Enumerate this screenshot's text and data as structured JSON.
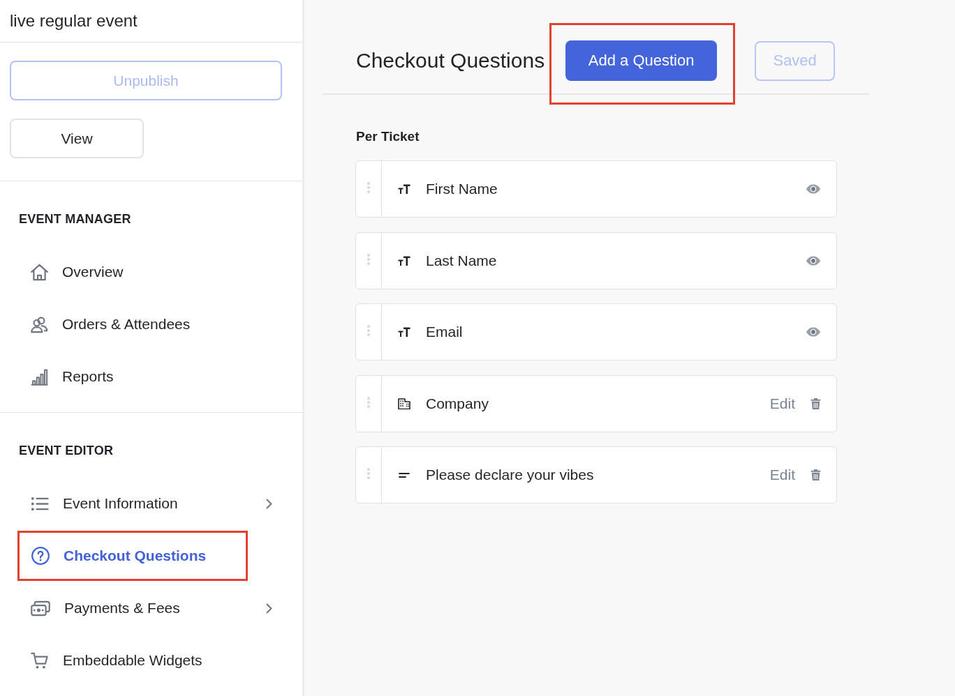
{
  "sidebar": {
    "event_title": "live regular event",
    "buttons": [
      {
        "label": "Unpublish",
        "kind": "primary",
        "disabled": true
      },
      {
        "label": "View",
        "kind": "secondary",
        "disabled": false
      }
    ],
    "sections": [
      {
        "heading": "EVENT MANAGER",
        "items": [
          {
            "label": "Overview",
            "selected": false,
            "has_submenu": false,
            "highlighted": false
          },
          {
            "label": "Orders & Attendees",
            "selected": false,
            "has_submenu": false,
            "highlighted": false
          },
          {
            "label": "Reports",
            "selected": false,
            "has_submenu": false,
            "highlighted": false
          }
        ]
      },
      {
        "heading": "EVENT EDITOR",
        "items": [
          {
            "label": "Event Information",
            "selected": false,
            "has_submenu": true,
            "highlighted": false
          },
          {
            "label": "Checkout Questions",
            "selected": true,
            "has_submenu": false,
            "highlighted": true
          },
          {
            "label": "Payments & Fees",
            "selected": false,
            "has_submenu": true,
            "highlighted": false
          },
          {
            "label": "Embeddable Widgets",
            "selected": false,
            "has_submenu": false,
            "highlighted": false
          }
        ]
      }
    ]
  },
  "main": {
    "title": "Checkout Questions",
    "add_button": {
      "label": "Add a Question",
      "highlighted": true
    },
    "save_button": {
      "label": "Saved",
      "disabled": true,
      "highlighted": false
    },
    "group_heading": "Per Ticket",
    "questions": [
      {
        "label": "First Name",
        "kind": "text",
        "editable": false
      },
      {
        "label": "Last Name",
        "kind": "text",
        "editable": false
      },
      {
        "label": "Email",
        "kind": "text",
        "editable": false
      },
      {
        "label": "Company",
        "kind": "company",
        "editable": true,
        "action": "Edit"
      },
      {
        "label": "Please declare your vibes",
        "kind": "short_text",
        "editable": true,
        "action": "Edit"
      }
    ]
  }
}
